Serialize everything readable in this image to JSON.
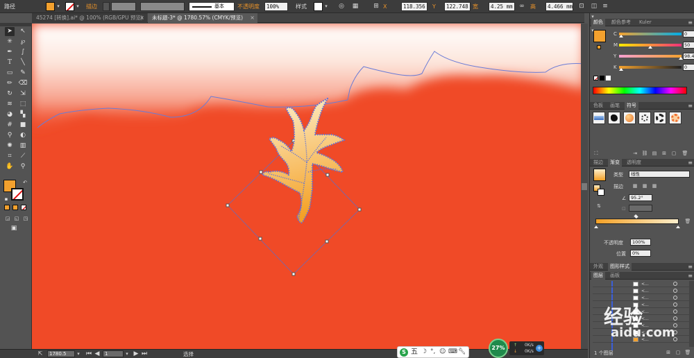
{
  "control_bar": {
    "object_type": "路径",
    "stroke_label": "描边",
    "stroke_profile": "基本",
    "opacity_label": "不透明度",
    "opacity_value": "100%",
    "style_label": "样式",
    "x_label": "X",
    "x_value": "118.356 r",
    "y_label": "Y",
    "y_value": "122.748 r",
    "w_label": "宽",
    "w_value": "4.25 mm",
    "h_label": "高",
    "h_value": "4.466 mm",
    "fill_color": "#f3a12e"
  },
  "tabs": [
    {
      "label": "45274 [转换].ai* @ 100% (RGB/GPU 预览)",
      "close": "×"
    },
    {
      "label": "未标题-3* @ 1780.57% (CMYK/预览)",
      "close": "×"
    }
  ],
  "tools": {
    "icons": [
      "selection-arrow",
      "direct-selection-arrow",
      "magic-wand",
      "lasso",
      "pen",
      "curvature",
      "type",
      "line",
      "rectangle",
      "paintbrush",
      "pencil",
      "eraser",
      "rotate",
      "scale",
      "warp",
      "width",
      "free-transform",
      "shape-builder",
      "perspective",
      "mesh",
      "gradient",
      "eyedropper",
      "blend",
      "symbol-sprayer",
      "column-graph",
      "artboard",
      "slice",
      "hand",
      "zoom"
    ],
    "fill_color": "#f3a12e",
    "stroke_color": "#ffffff"
  },
  "canvas": {
    "background_color": "#f04a27",
    "leaf_gradient_top": "#fdeecb",
    "leaf_gradient_bottom": "#f4a126",
    "selection_color": "#4f6fd8"
  },
  "status_bar": {
    "zoom": "1780.5",
    "artboard": "1",
    "tool_mode": "选择"
  },
  "ime": {
    "logo": "S",
    "mode": "五"
  },
  "network": {
    "percent": "27%",
    "up": "0K/s",
    "down": "0K/s",
    "plus": "+"
  },
  "panels": {
    "color": {
      "tabs": [
        "颜色",
        "颜色参考",
        "Kuler"
      ],
      "channels": [
        {
          "name": "C",
          "value": "0",
          "unit": "%"
        },
        {
          "name": "M",
          "value": "50",
          "unit": "%"
        },
        {
          "name": "Y",
          "value": "98.48",
          "unit": "%"
        },
        {
          "name": "K",
          "value": "0",
          "unit": "%"
        }
      ],
      "current": "#f3a12e"
    },
    "swatches": {
      "tabs": [
        "色板",
        "画笔",
        "符号"
      ],
      "footer_label": "ﾠ"
    },
    "gradient": {
      "tabs": [
        "描边",
        "渐变",
        "透明度"
      ],
      "type_label": "类型",
      "type_value": "线性",
      "stroke_label": "描边",
      "angle_value": "95.2°",
      "opacity_label": "不透明度",
      "opacity_value": "100%",
      "location_label": "位置",
      "location_value": "0%",
      "start_color": "#f4a126",
      "end_color": "#fdeecb"
    },
    "appearance": {
      "tabs": [
        "外观",
        "图形样式"
      ]
    },
    "layers": {
      "tabs": [
        "图层",
        "画板"
      ],
      "rows": [
        "<...",
        "<...",
        "<...",
        "<...",
        "<...",
        "<...",
        "<...",
        "<...",
        "<..."
      ],
      "footer": "1 个图层"
    }
  },
  "watermark": {
    "line1": "经验",
    "line2": "aidu.com"
  }
}
